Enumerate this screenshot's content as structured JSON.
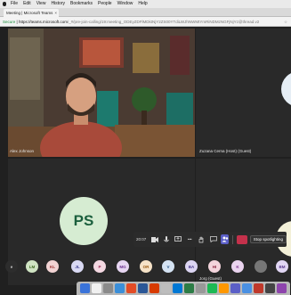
{
  "menubar": {
    "items": [
      "File",
      "Edit",
      "View",
      "History",
      "Bookmarks",
      "People",
      "Window",
      "Help"
    ]
  },
  "browser": {
    "tab_title": "Meeting | Microsoft Teams",
    "address_secure": "Secure",
    "address_host": "https://teams.microsoft.com",
    "address_path": "/_#/pre-join-calling/19:meeting_ODEyZDFlMDktNjY2ZS00YTdiLWJhNWMtYmRiNDMzNGFjNjYz@thread.v2"
  },
  "participants": {
    "tile1_name": "Alex Johnson",
    "tile2_name": "Zuzana Cerna (Host) (Guest)",
    "tile3_initials": "PS",
    "tile4_name": "Jorg (Guest)"
  },
  "controls": {
    "timer": "20:07",
    "stop_label": "Stop spotlighting"
  },
  "avatar_row": {
    "items": [
      {
        "initials": "e",
        "bg": "#2d2d2d",
        "fg": "#cfcfcf"
      },
      {
        "initials": "LM",
        "bg": "#cfe3c2",
        "fg": "#3f6a22"
      },
      {
        "initials": "KL",
        "bg": "#f2d3d3",
        "fg": "#9a2b2b"
      },
      {
        "initials": "JL",
        "bg": "#d9d9f3",
        "fg": "#3a3a8c"
      },
      {
        "initials": "P",
        "bg": "#f4d8e2",
        "fg": "#9c2b55"
      },
      {
        "initials": "MG",
        "bg": "#e7d6f2",
        "fg": "#6b2f8e"
      },
      {
        "initials": "OR",
        "bg": "#f6e2c7",
        "fg": "#9a5a12"
      },
      {
        "initials": "V",
        "bg": "#d5e3f3",
        "fg": "#2d5a8c"
      },
      {
        "initials": "BA",
        "bg": "#dcd5f2",
        "fg": "#4a3a8c"
      },
      {
        "initials": "HI",
        "bg": "#f3d4dc",
        "fg": "#8c2a44"
      },
      {
        "initials": "K",
        "bg": "#ead4ef",
        "fg": "#7a2f8c"
      },
      {
        "initials": "",
        "bg": "#777777",
        "fg": "#ffffff"
      },
      {
        "initials": "BM",
        "bg": "#e1d6f3",
        "fg": "#5a3a8c"
      }
    ]
  },
  "dock": {
    "icons": [
      "#3a73d9",
      "#f0f0f0",
      "#8a8a8a",
      "#3b8fd9",
      "#e34c26",
      "#2b5797",
      "#d83b01",
      "#bdbdbd",
      "#0078d4",
      "#2d7d46",
      "#999999",
      "#1db954",
      "#ff9800",
      "#5b5fc7",
      "#4a90e2",
      "#c0392b",
      "#444444",
      "#8e44ad"
    ]
  },
  "colors": {
    "accent": "#5b5fc7",
    "hangup": "#c4314b"
  }
}
